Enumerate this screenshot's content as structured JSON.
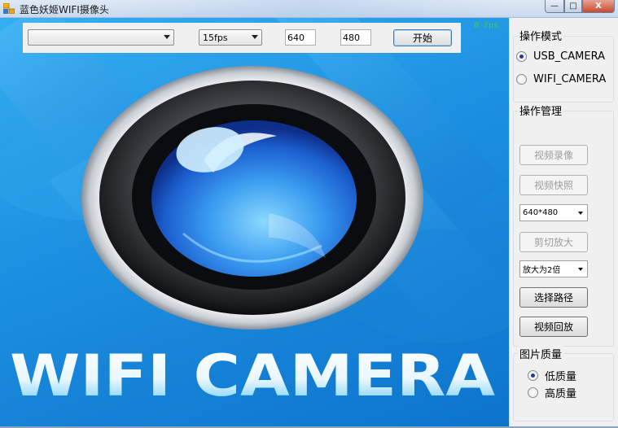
{
  "window": {
    "title": "蓝色妖姬WIFI摄像头",
    "controls": {
      "minimize": "—",
      "maximize": "□",
      "close": "X"
    }
  },
  "toolbar": {
    "device_select": {
      "value": ""
    },
    "fps_select": {
      "value": "15fps"
    },
    "width_input": "640",
    "height_input": "480",
    "start_button": "开始"
  },
  "video": {
    "fps_readout": "0 fps",
    "splash_text": "WIFI CAMERA"
  },
  "panel": {
    "mode_group": {
      "title": "操作模式",
      "options": [
        {
          "label": "USB_CAMERA",
          "checked": true
        },
        {
          "label": "WIFI_CAMERA",
          "checked": false
        }
      ]
    },
    "manage_group": {
      "title": "操作管理",
      "record_button": "视频录像",
      "snapshot_button": "视频快照",
      "resolution_select": "640*480",
      "crop_zoom_button": "剪切放大",
      "zoom_select": "放大为2倍",
      "choose_path_button": "选择路径",
      "playback_button": "视频回放"
    },
    "quality_group": {
      "title": "图片质量",
      "options": [
        {
          "label": "低质量",
          "checked": true
        },
        {
          "label": "高质量",
          "checked": false
        }
      ]
    }
  },
  "colors": {
    "video_bg": "#1c8fe0",
    "fps_text": "#39d24a",
    "lens_blue": "#1e6fe0"
  },
  "icons": [
    "app-icon",
    "dropdown-arrow-icon",
    "camera-lens-icon"
  ]
}
